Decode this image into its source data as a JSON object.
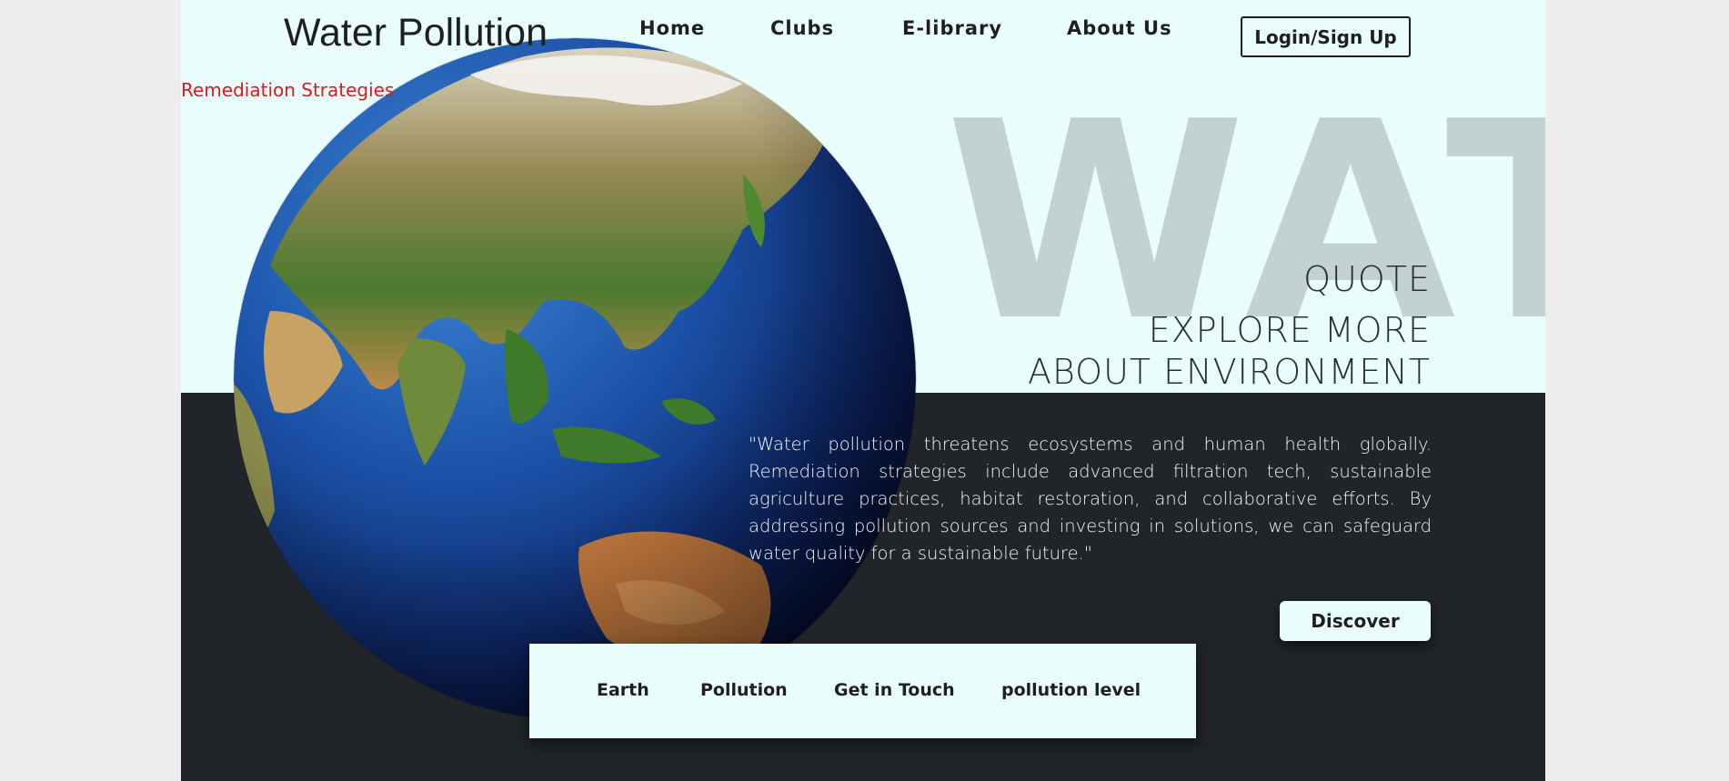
{
  "header": {
    "site_title": "Water Pollution",
    "subtitle": "Remediation Strategies",
    "nav": [
      "Home",
      "Clubs",
      "E-library",
      "About Us"
    ],
    "login_label": "Login/Sign Up"
  },
  "hero": {
    "background_word": "WATER",
    "quote_heading": "QUOTE",
    "tagline_line1": "EXPLORE MORE",
    "tagline_line2": "ABOUT ENVIRONMENT",
    "quote_text": "\"Water pollution threatens ecosystems and human health globally. Remediation strategies include advanced filtration tech, sustainable agriculture practices, habitat restoration, and collaborative efforts. By addressing pollution sources and investing in solutions, we can safeguard water quality for a sustainable future.\"",
    "discover_label": "Discover"
  },
  "bottom_nav": [
    "Earth",
    "Pollution",
    "Get in Touch",
    "pollution level"
  ],
  "colors": {
    "page_bg": "#e9fefc",
    "dark_band": "#212428",
    "accent_red": "#e0161e",
    "background_word": "#c3d1d0",
    "text_dark": "#1f1f1f"
  },
  "icons": {
    "hero_image": "earth-globe-icon"
  }
}
